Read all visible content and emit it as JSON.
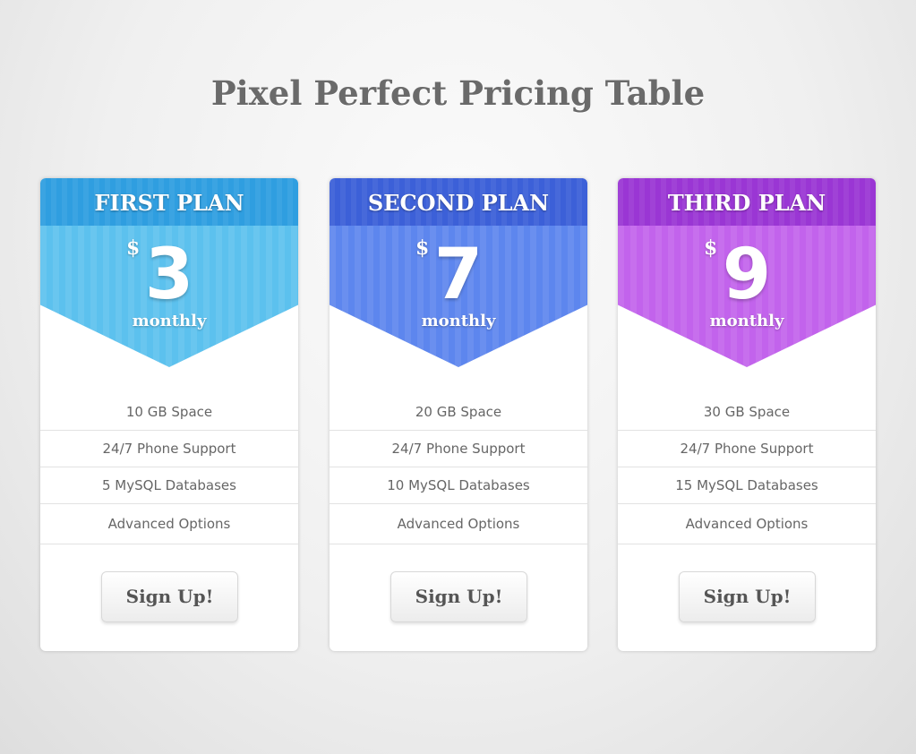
{
  "title": "Pixel Perfect Pricing Table",
  "plans": [
    {
      "name": "FIRST PLAN",
      "currency": "$",
      "price": "3",
      "period": "monthly",
      "features": [
        "10 GB Space",
        "24/7 Phone Support",
        "5 MySQL Databases",
        "Advanced Options"
      ],
      "button": "Sign Up!",
      "header_color": "#2f9ee0",
      "band_color": "#5cc1ee"
    },
    {
      "name": "SECOND PLAN",
      "currency": "$",
      "price": "7",
      "period": "monthly",
      "features": [
        "20 GB Space",
        "24/7 Phone Support",
        "10 MySQL Databases",
        "Advanced Options"
      ],
      "button": "Sign Up!",
      "header_color": "#3c60d8",
      "band_color": "#5d86ee"
    },
    {
      "name": "THIRD PLAN",
      "currency": "$",
      "price": "9",
      "period": "monthly",
      "features": [
        "30 GB Space",
        "24/7 Phone Support",
        "15 MySQL Databases",
        "Advanced Options"
      ],
      "button": "Sign Up!",
      "header_color": "#9a36d4",
      "band_color": "#c263ec"
    }
  ]
}
